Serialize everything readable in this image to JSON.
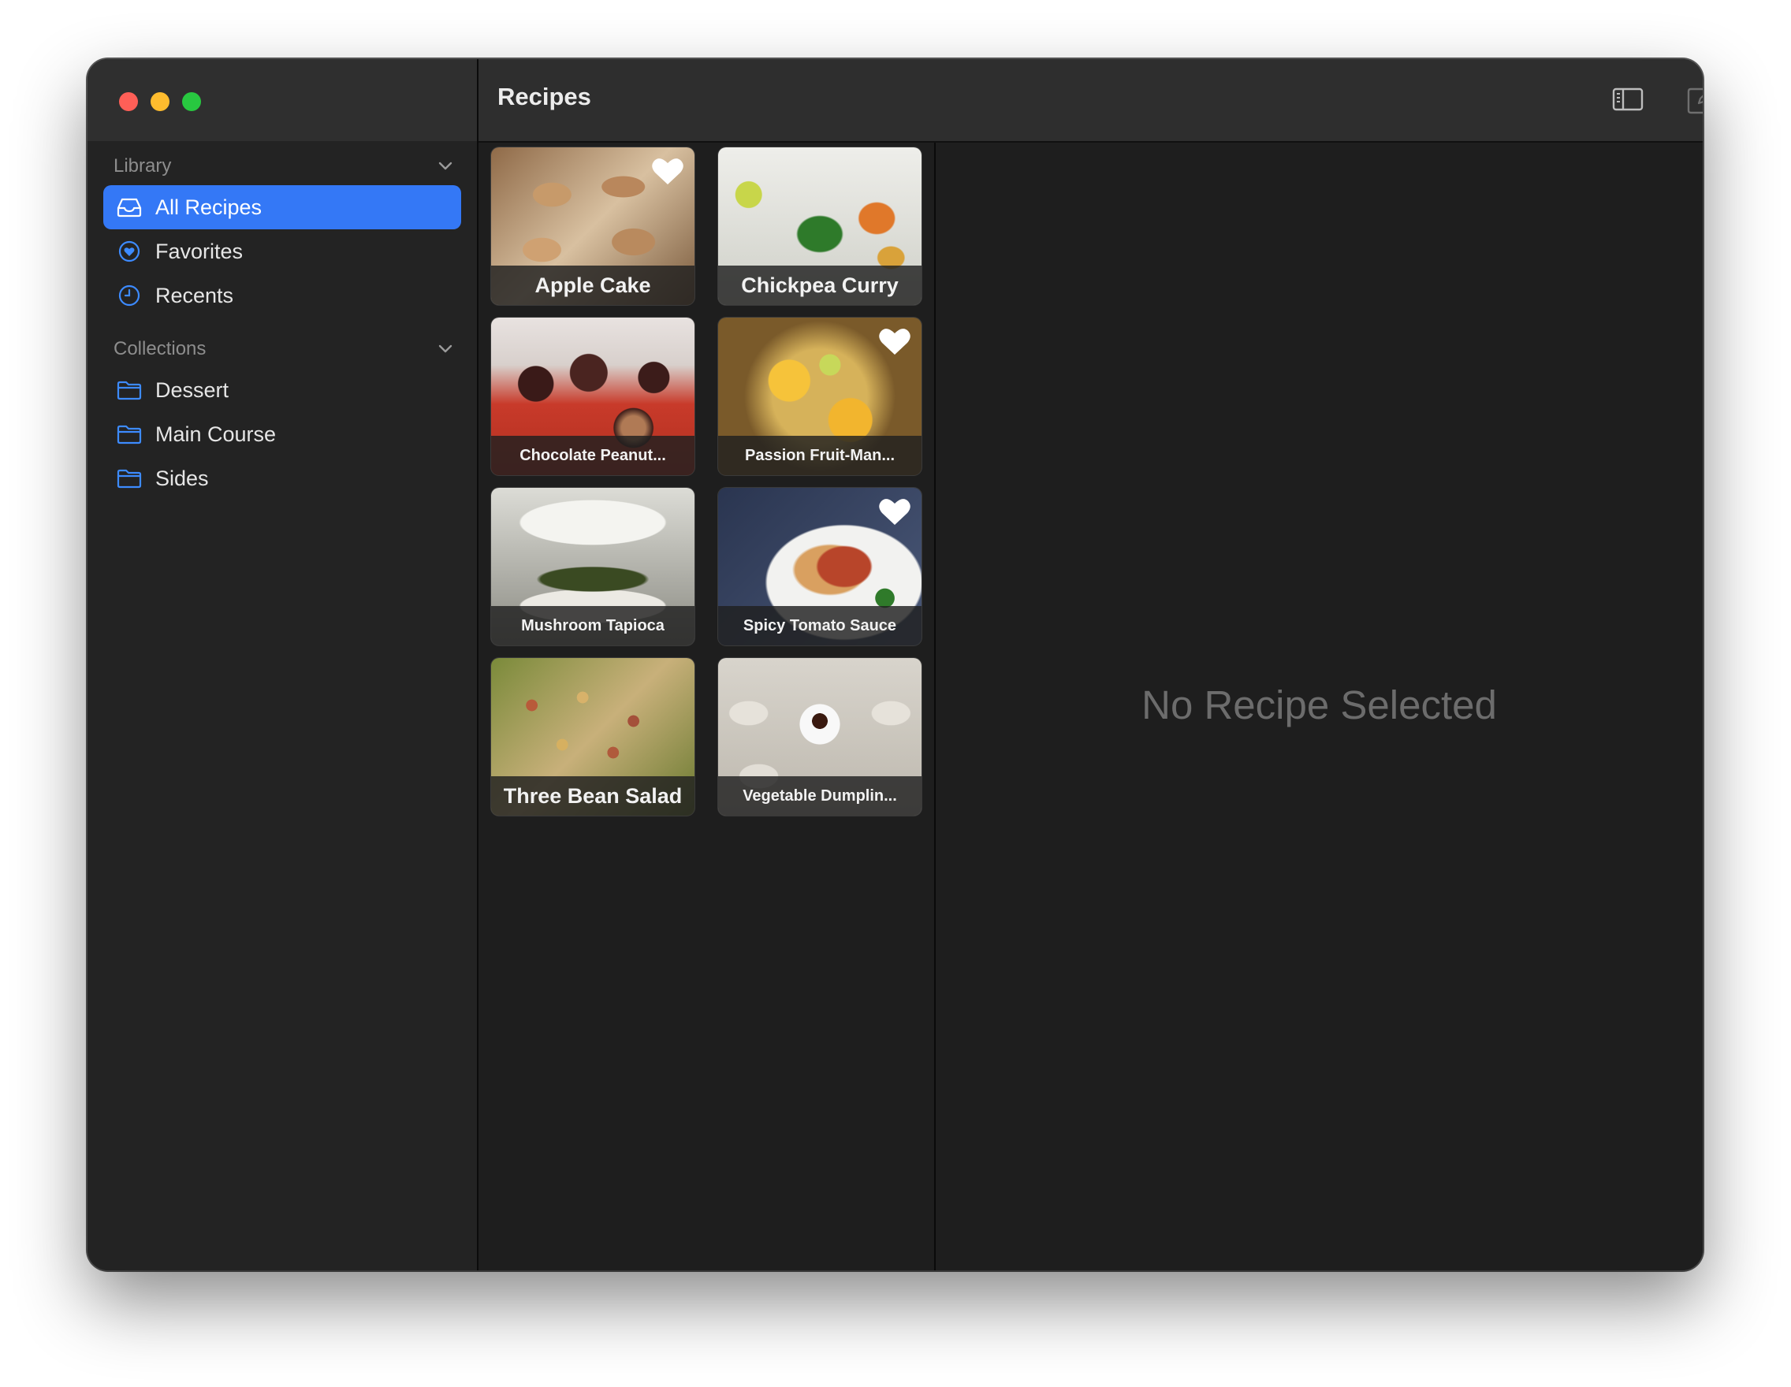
{
  "window": {
    "title": "Recipes",
    "traffic_lights": {
      "close": "#ff5f57",
      "minimize": "#febc2e",
      "zoom": "#28c840"
    }
  },
  "toolbar": {
    "icons": [
      "sidebar-toggle-icon",
      "compose-icon",
      "heart-icon"
    ]
  },
  "sidebar": {
    "library": {
      "header": "Library",
      "items": [
        {
          "label": "All Recipes",
          "icon": "tray-icon",
          "selected": true
        },
        {
          "label": "Favorites",
          "icon": "heart-circle-icon",
          "selected": false
        },
        {
          "label": "Recents",
          "icon": "clock-icon",
          "selected": false
        }
      ]
    },
    "collections": {
      "header": "Collections",
      "items": [
        {
          "label": "Dessert",
          "icon": "folder-icon"
        },
        {
          "label": "Main Course",
          "icon": "folder-icon"
        },
        {
          "label": "Sides",
          "icon": "folder-icon"
        }
      ]
    }
  },
  "recipes": [
    {
      "name": "Apple Cake",
      "favorite": true
    },
    {
      "name": "Chickpea Curry",
      "favorite": false
    },
    {
      "name": "Chocolate Peanut...",
      "favorite": false
    },
    {
      "name": "Passion Fruit-Man...",
      "favorite": true
    },
    {
      "name": "Mushroom Tapioca",
      "favorite": false
    },
    {
      "name": "Spicy Tomato Sauce",
      "favorite": true
    },
    {
      "name": "Three Bean Salad",
      "favorite": false
    },
    {
      "name": "Vegetable Dumplin...",
      "favorite": false
    }
  ],
  "detail": {
    "empty_message": "No Recipe Selected"
  },
  "colors": {
    "accent": "#3478f6",
    "sidebar_bg": "#232323",
    "content_bg": "#1e1e1e"
  }
}
